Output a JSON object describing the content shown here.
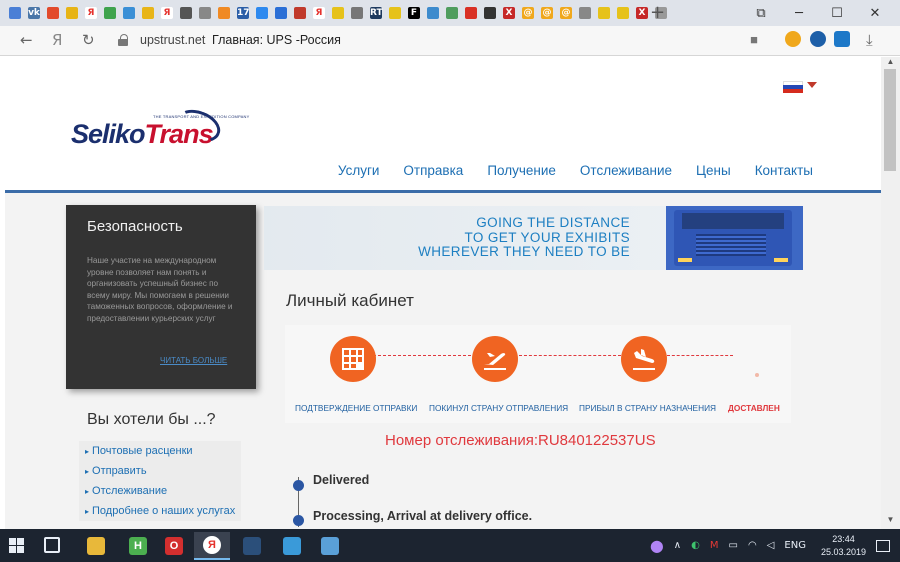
{
  "browser": {
    "favicon_tabs": [
      {
        "icon": "blue-docs-icon",
        "color": "#4a7fd6",
        "glyph": ""
      },
      {
        "icon": "vk-icon",
        "color": "#4a76a8",
        "glyph": "vk"
      },
      {
        "icon": "mail-icon",
        "color": "#e24a2b",
        "glyph": ""
      },
      {
        "icon": "gold-icon",
        "color": "#e7b416",
        "glyph": ""
      },
      {
        "icon": "yandex-icon",
        "color": "#ffffff",
        "glyph": "Я"
      },
      {
        "icon": "multi-icon",
        "color": "#3fa34d",
        "glyph": ""
      },
      {
        "icon": "bird-icon",
        "color": "#3a8fd6",
        "glyph": ""
      },
      {
        "icon": "mail-envelope-icon",
        "color": "#e8b518",
        "glyph": ""
      },
      {
        "icon": "yandex-icon",
        "color": "#ffffff",
        "glyph": "Я"
      },
      {
        "icon": "briefcase-icon",
        "color": "#555555",
        "glyph": ""
      },
      {
        "icon": "search-icon",
        "color": "#888888",
        "glyph": ""
      },
      {
        "icon": "pie-icon",
        "color": "#f08a24",
        "glyph": ""
      },
      {
        "icon": "calendar-icon",
        "color": "#2b5ea7",
        "glyph": "17"
      },
      {
        "icon": "windows-icon",
        "color": "#2d89ef",
        "glyph": ""
      },
      {
        "icon": "circle-icon",
        "color": "#2b6fd6",
        "glyph": ""
      },
      {
        "icon": "book-icon",
        "color": "#c0392b",
        "glyph": ""
      },
      {
        "icon": "yandex-icon",
        "color": "#ffffff",
        "glyph": "Я"
      },
      {
        "icon": "car-icon",
        "color": "#e6c21a",
        "glyph": ""
      },
      {
        "icon": "doc-icon",
        "color": "#777777",
        "glyph": ""
      },
      {
        "icon": "rt-icon",
        "color": "#1e3a5f",
        "glyph": "RT"
      },
      {
        "icon": "car-icon",
        "color": "#e6c21a",
        "glyph": ""
      },
      {
        "icon": "forbes-icon",
        "color": "#000000",
        "glyph": "F"
      },
      {
        "icon": "picture-icon",
        "color": "#3d8bcd",
        "glyph": ""
      },
      {
        "icon": "grid-icon",
        "color": "#4f9d5e",
        "glyph": ""
      },
      {
        "icon": "flag-icon",
        "color": "#d93025",
        "glyph": ""
      },
      {
        "icon": "bookmark-icon",
        "color": "#333333",
        "glyph": ""
      },
      {
        "icon": "x-icon",
        "color": "#c62828",
        "glyph": "X"
      },
      {
        "icon": "at-icon",
        "color": "#f0a81c",
        "glyph": "@"
      },
      {
        "icon": "at-icon",
        "color": "#f0a81c",
        "glyph": "@"
      },
      {
        "icon": "at-icon",
        "color": "#f0a81c",
        "glyph": "@"
      },
      {
        "icon": "search-icon",
        "color": "#888888",
        "glyph": ""
      },
      {
        "icon": "car-icon",
        "color": "#e6c21a",
        "glyph": ""
      },
      {
        "icon": "car-icon",
        "color": "#e6c21a",
        "glyph": ""
      },
      {
        "icon": "x-icon",
        "color": "#c62828",
        "glyph": "X"
      },
      {
        "icon": "doc-icon",
        "color": "#999999",
        "glyph": ""
      }
    ],
    "new_tab": "+",
    "window_controls": {
      "bookmarks": "⧉",
      "minimize": "─",
      "maximize": "☐",
      "close": "✕"
    },
    "nav": {
      "back": "←",
      "yandex": "Я",
      "reload": "↻"
    },
    "url_domain": "upstrust.net",
    "page_title": "Главная: UPS -Россия",
    "bookmark_star": "■",
    "download": "⤓"
  },
  "site": {
    "logo": {
      "word1": "Seliko",
      "word2": "Trans",
      "tagline": "THE TRANSPORT AND EXPEDITION COMPANY"
    },
    "nav": [
      "Услуги",
      "Отправка",
      "Получение",
      "Отслеживание",
      "Цены",
      "Контакты"
    ],
    "security": {
      "title": "Безопасность",
      "text": "Наше участие на международном уровне позволяет нам понять и организовать успешный бизнес по всему миру. Мы помогаем в решении таможенных вопросов, оформление и предоставлении курьерских услуг",
      "more": "ЧИТАТЬ БОЛЬШЕ"
    },
    "wish": {
      "title": "Вы хотели бы ...?",
      "items": [
        "Почтовые расценки",
        "Отправить",
        "Отслеживание",
        "Подробнее о наших услугах"
      ]
    },
    "banner": {
      "line1": "GOING THE DISTANCE",
      "line2": "TO GET YOUR EXHIBITS",
      "line3": "WHEREVER THEY NEED TO BE"
    },
    "cabinet": {
      "title": "Личный кабинет",
      "steps": [
        {
          "label": "ПОДТВЕРЖДЕНИЕ ОТПРАВКИ",
          "icon": "grid-doc-icon"
        },
        {
          "label": "ПОКИНУЛ СТРАНУ ОТПРАВЛЕНИЯ",
          "icon": "plane-takeoff-icon"
        },
        {
          "label": "ПРИБЫЛ В СТРАНУ НАЗНАЧЕНИЯ",
          "icon": "plane-landing-icon"
        },
        {
          "label": "ДОСТАВЛЕН",
          "icon": ""
        }
      ],
      "tracking": "Номер отслеживания:RU840122537US",
      "events": [
        "Delivered",
        "Processing, Arrival at delivery office."
      ]
    }
  },
  "taskbar": {
    "apps": [
      {
        "icon": "file-explorer-icon",
        "color": "#e8b83a",
        "glyph": ""
      },
      {
        "icon": "notepad-h-icon",
        "color": "#4caf50",
        "glyph": "H"
      },
      {
        "icon": "opera-icon",
        "color": "#d32f2f",
        "glyph": "O"
      },
      {
        "icon": "yandex-browser-icon",
        "color": "#ffffff",
        "glyph": "Я"
      },
      {
        "icon": "ccleaner-icon",
        "color": "#2b4f7a",
        "glyph": ""
      },
      {
        "icon": "paint-icon",
        "color": "#3a9ad9",
        "glyph": ""
      },
      {
        "icon": "book-icon",
        "color": "#5aa0d8",
        "glyph": ""
      }
    ],
    "tray": {
      "alice": "●",
      "chevron": "∧",
      "lang": "ENG",
      "time": "23:44",
      "date": "25.03.2019"
    }
  },
  "colors": {
    "accent": "#1d6fb3",
    "orange": "#f06422",
    "red": "#e0393e",
    "dark": "#333333"
  }
}
